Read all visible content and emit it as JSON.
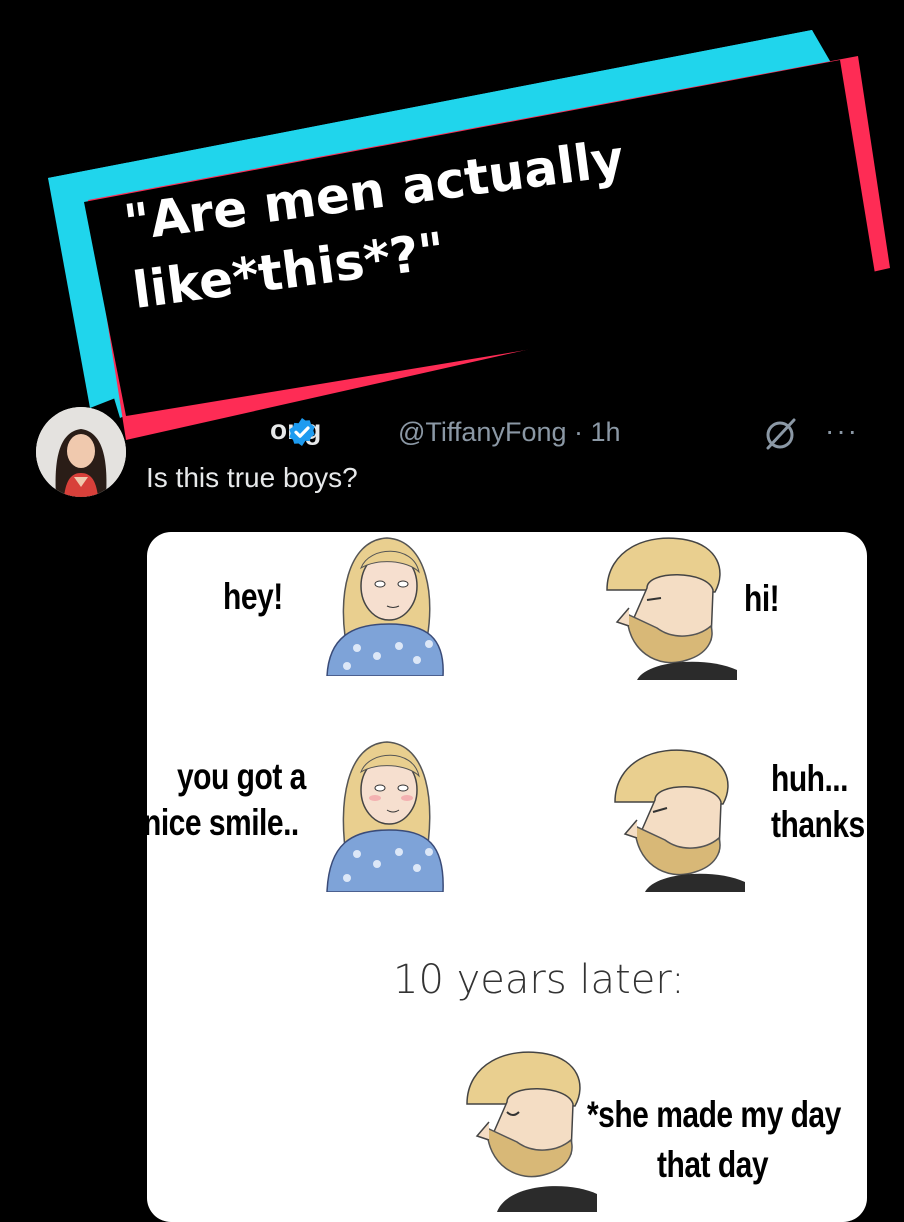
{
  "banner": {
    "line1": "\"Are men actually",
    "line2": "like*this*?\""
  },
  "tweet": {
    "name_fragment": "ong",
    "handle_time": "@TiffanyFong · 1h",
    "more": "···",
    "text": "Is this true boys?"
  },
  "meme": {
    "p1_left": "hey!",
    "p1_right": "hi!",
    "p2_left_line1": "you got a",
    "p2_left_line2": "nice smile..",
    "p2_right_line1": "huh...",
    "p2_right_line2": "thanks",
    "later": "10 years later:",
    "final_line1": "*she made my day",
    "final_line2": "that day"
  },
  "colors": {
    "banner_cyan": "#20d5ec",
    "banner_red": "#fe2c55",
    "verified_blue": "#1d9bf0",
    "handle_grey": "#8b98a5"
  },
  "icons": [
    "verified-badge-icon",
    "grok-icon",
    "more-options-icon"
  ]
}
